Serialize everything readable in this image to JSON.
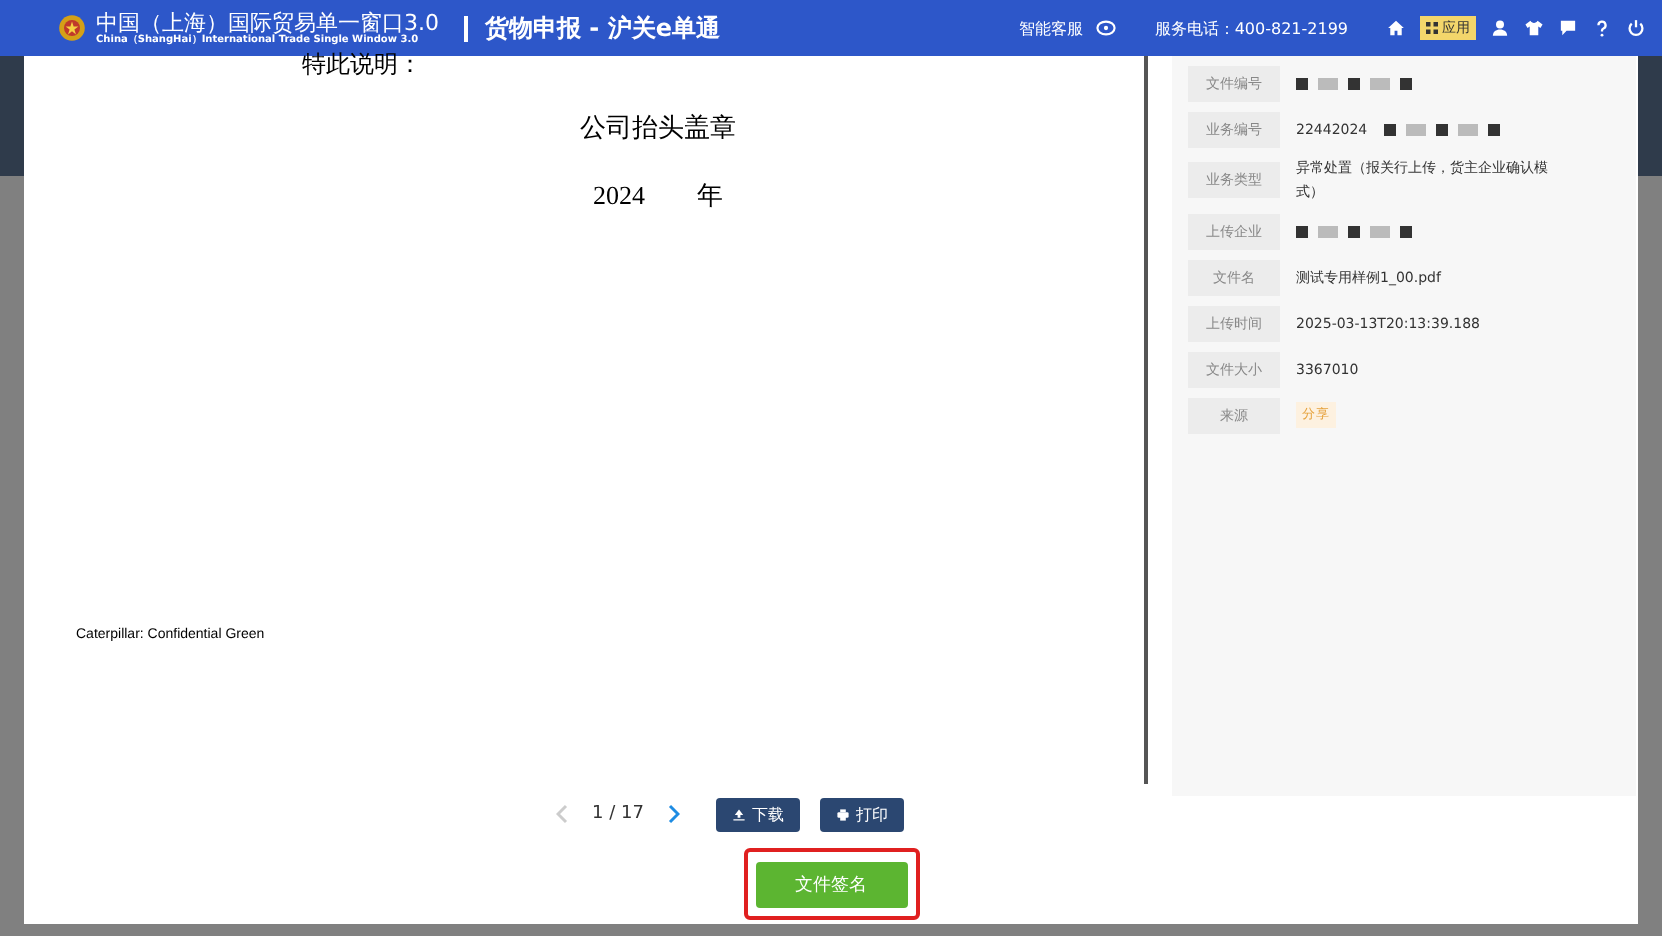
{
  "header": {
    "title": "中国（上海）国际贸易单一窗口3.0",
    "subtitle": "China（ShangHai）International Trade Single Window 3.0",
    "module": "货物申报 - 沪关e单通",
    "service": "智能客服",
    "phone": "服务电话：400-821-2199",
    "apps": "应用"
  },
  "document": {
    "lines": [
      {
        "kind": "heading",
        "text": "特此说明："
      },
      {
        "kind": "center",
        "text": "公司抬头盖章"
      },
      {
        "kind": "center",
        "text": "2024　　年"
      },
      {
        "kind": "footer",
        "text": "Caterpillar: Confidential Green"
      }
    ]
  },
  "pager": {
    "page": "1 / 17",
    "prev_disabled": true,
    "next_disabled": false
  },
  "actions": [
    "下载",
    "打印"
  ],
  "info": [
    {
      "label": "文件编号",
      "kind": "redacted"
    },
    {
      "label": "业务编号",
      "kind": "redacted",
      "value": "22442024"
    },
    {
      "label": "业务类型",
      "kind": "text",
      "value": "异常处置（报关行上传，货主企业确认模式）"
    },
    {
      "label": "上传企业",
      "kind": "redacted"
    },
    {
      "label": "文件名",
      "kind": "text",
      "value": "测试专用样例1_00.pdf"
    },
    {
      "label": "上传时间",
      "kind": "text",
      "value": "2025-03-13T20:13:39.188"
    },
    {
      "label": "文件大小",
      "kind": "text",
      "value": "3367010"
    },
    {
      "label": "来源",
      "kind": "tag",
      "value": "分享"
    }
  ],
  "sign_button": {
    "label": "文件签名",
    "highlighted": true
  }
}
